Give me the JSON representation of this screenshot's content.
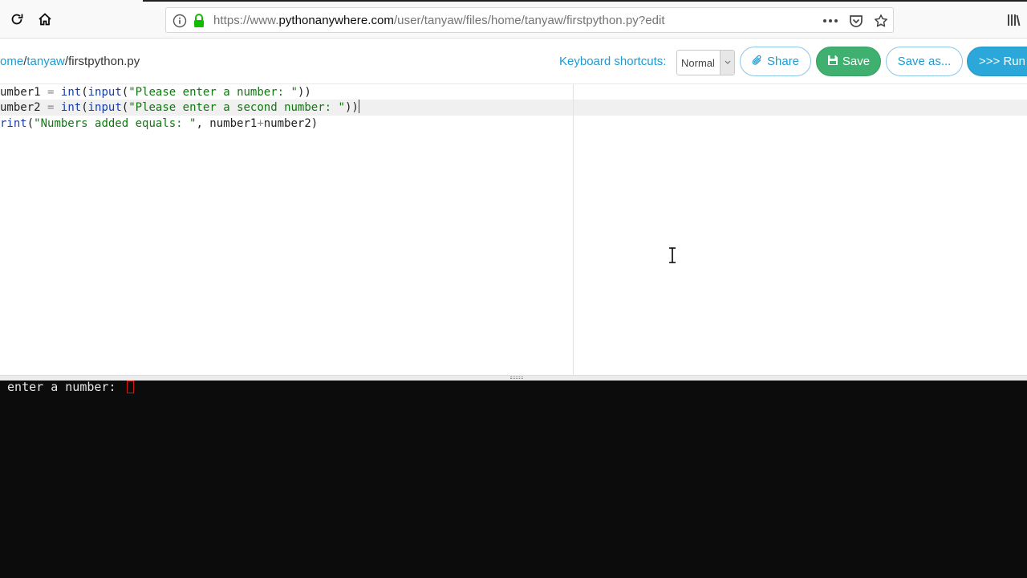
{
  "browser": {
    "url_prefix": "https://www.",
    "url_host": "pythonanywhere.com",
    "url_path": "/user/tanyaw/files/home/tanyaw/firstpython.py?edit",
    "icons": [
      "reload-icon",
      "home-icon",
      "info-icon",
      "lock-icon",
      "more-icon",
      "pocket-icon",
      "star-icon",
      "library-icon"
    ]
  },
  "header": {
    "breadcrumb_home": "ome",
    "breadcrumb_sep1": "/",
    "breadcrumb_user": "tanyaw",
    "breadcrumb_sep2": "/",
    "breadcrumb_file": "firstpython.py",
    "shortcuts_label": "Keyboard shortcuts:",
    "shortcuts_mode": "Normal",
    "share_label": "Share",
    "save_label": "Save",
    "saveas_label": "Save as...",
    "run_label": ">>> Run"
  },
  "editor": {
    "line1": {
      "a": "umber1 ",
      "b": "=",
      "c": " ",
      "d": "int",
      "e": "(",
      "f": "input",
      "g": "(",
      "h": "\"Please enter a number: \"",
      "i": "))"
    },
    "line2": {
      "a": "umber2 ",
      "b": "=",
      "c": " ",
      "d": "int",
      "e": "(",
      "f": "input",
      "g": "(",
      "h": "\"Please enter a second number: \"",
      "i": "))"
    },
    "line3": {
      "a": "rint",
      "b": "(",
      "c": "\"Numbers added equals: \"",
      "d": ", number1",
      "e": "+",
      "f": "number2)"
    }
  },
  "console": {
    "prompt_text": " enter a number: "
  },
  "colors": {
    "accent": "#1d9bd1",
    "save_green": "#3fb06f",
    "run_blue": "#2ba8d9",
    "keyword": "#1a3ea8",
    "string": "#117711",
    "console_bg": "#0c0c0c"
  }
}
